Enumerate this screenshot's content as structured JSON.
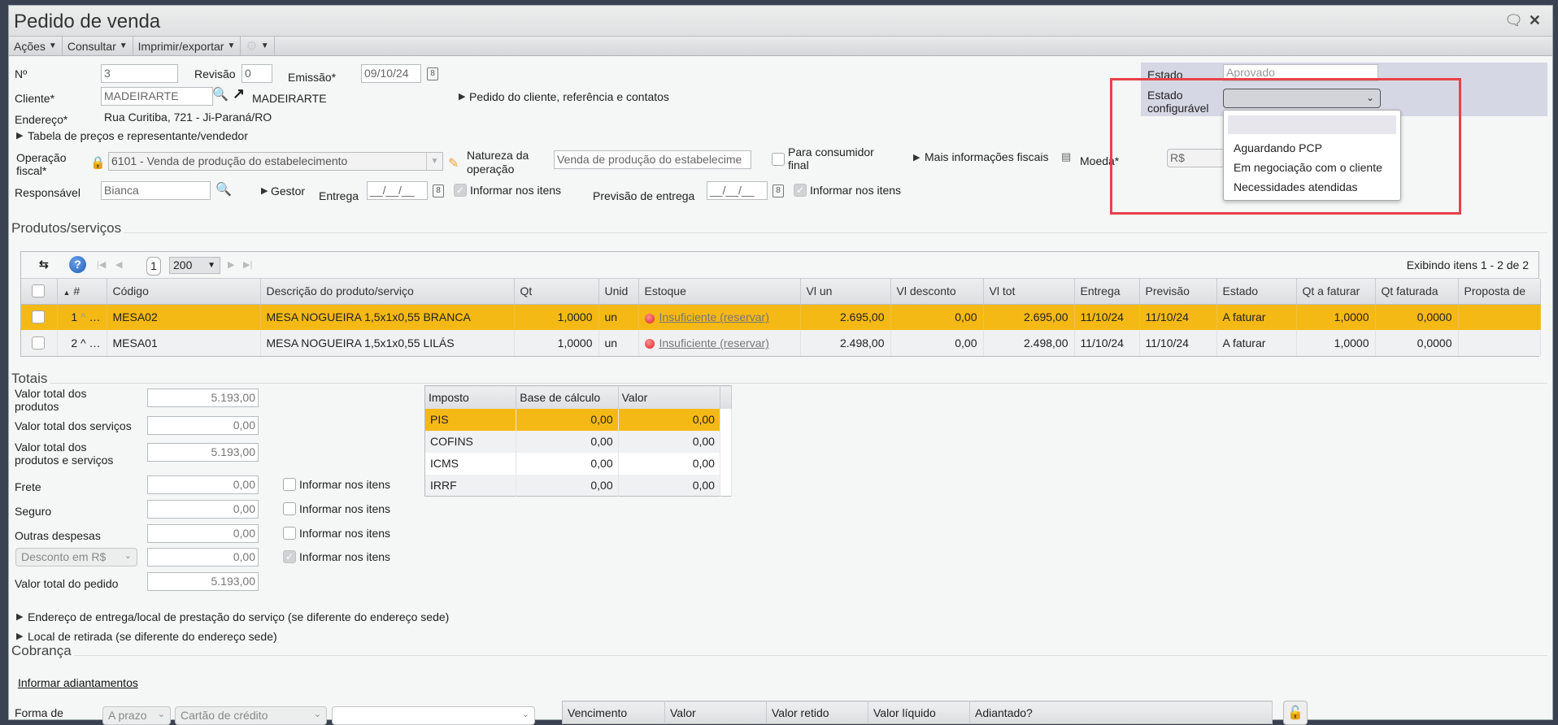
{
  "window": {
    "title": "Pedido de venda"
  },
  "toolbar": {
    "acoes": "Ações",
    "consultar": "Consultar",
    "imprimir": "Imprimir/exportar"
  },
  "form": {
    "numero_label": "Nº",
    "numero": "3",
    "revisao_label": "Revisão",
    "revisao": "0",
    "emissao_label": "Emissão*",
    "emissao": "09/10/24",
    "cliente_label": "Cliente*",
    "cliente": "MADEIRARTE",
    "cliente_nome": "MADEIRARTE",
    "pedido_cliente_link": "Pedido do cliente, referência e contatos",
    "endereco_label": "Endereço*",
    "endereco": "Rua Curitiba, 721 - Ji-Paraná/RO",
    "tabela_link": "Tabela de preços e representante/vendedor",
    "operacao_label1": "Operação",
    "operacao_label2": "fiscal*",
    "operacao": "6101 - Venda de produção do estabelecimento",
    "natureza_label1": "Natureza da",
    "natureza_label2": "operação",
    "natureza": "Venda de produção do estabelecime",
    "consumidor_label1": "Para consumidor",
    "consumidor_label2": "final",
    "mais_info": "Mais informações fiscais",
    "moeda_label": "Moeda*",
    "moeda": "R$",
    "responsavel_label": "Responsável",
    "responsavel": "Bianca",
    "gestor": "Gestor",
    "entrega_label": "Entrega",
    "entrega": "__/__/__",
    "informar_itens": "Informar nos itens",
    "previsao_label": "Previsão de entrega",
    "previsao": "__/__/__"
  },
  "estado": {
    "label": "Estado",
    "value": "Aprovado",
    "config_label1": "Estado",
    "config_label2": "configurável",
    "options": [
      "",
      "Aguardando PCP",
      "Em negociação com o cliente",
      "Necessidades atendidas"
    ]
  },
  "produtos": {
    "title": "Produtos/serviços",
    "page": "1",
    "page_size": "200",
    "exibindo": "Exibindo itens 1 - 2 de 2",
    "columns": [
      "#",
      "Código",
      "Descrição do produto/serviço",
      "Qt",
      "Unid",
      "Estoque",
      "Vl un",
      "Vl desconto",
      "Vl tot",
      "Entrega",
      "Previsão",
      "Estado",
      "Qt a faturar",
      "Qt faturada",
      "Proposta de"
    ],
    "rows": [
      {
        "n": "1",
        "codigo": "MESA02",
        "descricao": "MESA NOGUEIRA 1,5x1x0,55 BRANCA",
        "qt": "1,0000",
        "unid": "un",
        "estoque": "Insuficiente (reservar)",
        "vl_un": "2.695,00",
        "vl_desc": "0,00",
        "vl_tot": "2.695,00",
        "entrega": "11/10/24",
        "previsao": "11/10/24",
        "estado": "A faturar",
        "qt_faturar": "1,0000",
        "qt_faturada": "0,0000"
      },
      {
        "n": "2",
        "codigo": "MESA01",
        "descricao": "MESA NOGUEIRA 1,5x1x0,55 LILÁS",
        "qt": "1,0000",
        "unid": "un",
        "estoque": "Insuficiente (reservar)",
        "vl_un": "2.498,00",
        "vl_desc": "0,00",
        "vl_tot": "2.498,00",
        "entrega": "11/10/24",
        "previsao": "11/10/24",
        "estado": "A faturar",
        "qt_faturar": "1,0000",
        "qt_faturada": "0,0000"
      }
    ]
  },
  "totais": {
    "title": "Totais",
    "produtos_l1": "Valor total dos",
    "produtos_l2": "produtos",
    "produtos": "5.193,00",
    "servicos_label": "Valor total dos serviços",
    "servicos": "0,00",
    "prodserv_l1": "Valor total dos",
    "prodserv_l2": "produtos e serviços",
    "prodserv": "5.193,00",
    "frete_label": "Frete",
    "frete": "0,00",
    "seguro_label": "Seguro",
    "seguro": "0,00",
    "outras_label": "Outras despesas",
    "outras": "0,00",
    "desconto_tipo": "Desconto em R$",
    "desconto": "0,00",
    "pedido_label": "Valor total do pedido",
    "pedido": "5.193,00",
    "informar": "Informar nos itens"
  },
  "impostos": {
    "columns": [
      "Imposto",
      "Base de cálculo",
      "Valor"
    ],
    "rows": [
      [
        "PIS",
        "0,00",
        "0,00"
      ],
      [
        "COFINS",
        "0,00",
        "0,00"
      ],
      [
        "ICMS",
        "0,00",
        "0,00"
      ],
      [
        "IRRF",
        "0,00",
        "0,00"
      ]
    ]
  },
  "links": {
    "endereco_entrega": "Endereço de entrega/local de prestação do serviço (se diferente do endereço sede)",
    "local_retirada": "Local de retirada (se diferente do endereço sede)"
  },
  "cobranca": {
    "title": "Cobrança",
    "adiantamentos": "Informar adiantamentos",
    "forma_label": "Forma de",
    "prazo": "A prazo",
    "cartao": "Cartão de crédito",
    "columns": [
      "Vencimento",
      "Valor",
      "Valor retido",
      "Valor líquido",
      "Adiantado?"
    ]
  }
}
